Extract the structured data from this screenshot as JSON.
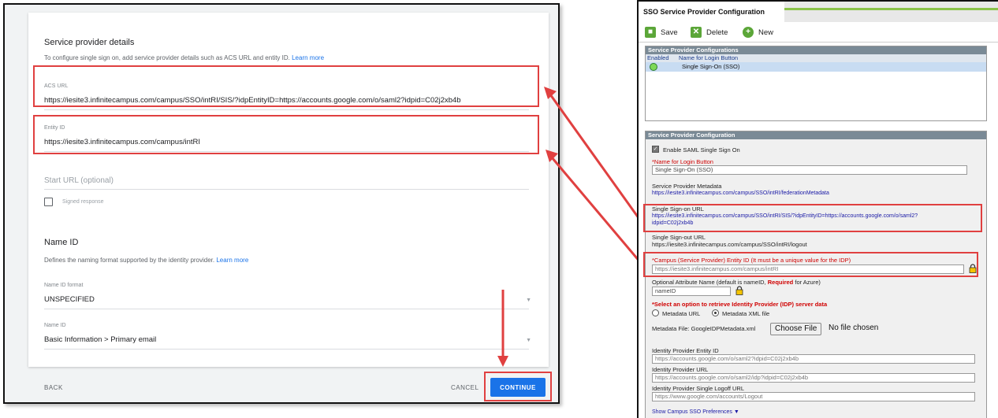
{
  "google": {
    "sp_details": {
      "title": "Service provider details",
      "desc": "To configure single sign on, add service provider details such as ACS URL and entity ID.",
      "learn_more": "Learn more"
    },
    "acs": {
      "label": "ACS URL",
      "value": "https://iesite3.infinitecampus.com/campus/SSO/intRI/SIS/?idpEntityID=https://accounts.google.com/o/saml2?idpid=C02j2xb4b"
    },
    "entity": {
      "label": "Entity ID",
      "value": "https://iesite3.infinitecampus.com/campus/intRI"
    },
    "start_url": {
      "placeholder": "Start URL (optional)"
    },
    "signed_response": {
      "label": "Signed response",
      "checked": false
    },
    "name_id": {
      "title": "Name ID",
      "desc": "Defines the naming format supported by the identity provider.",
      "learn_more": "Learn more",
      "format_label": "Name ID format",
      "format_value": "UNSPECIFIED",
      "id_label": "Name ID",
      "id_value": "Basic Information > Primary email"
    },
    "footer": {
      "back": "BACK",
      "cancel": "CANCEL",
      "continue": "CONTINUE"
    },
    "colors": {
      "primary": "#1a73e8",
      "highlight": "#e04040"
    }
  },
  "campus": {
    "tab": "SSO Service Provider Configuration",
    "toolbar": {
      "save": "Save",
      "delete": "Delete",
      "new": "New"
    },
    "list": {
      "header": "Service Provider Configurations",
      "col_enabled": "Enabled",
      "col_name": "Name for Login Button",
      "row_name": "Single Sign-On (SSO)"
    },
    "config": {
      "header": "Service Provider Configuration",
      "enable_saml": "Enable SAML Single Sign On",
      "login_button_label": "*Name for Login Button",
      "login_button_value": "Single Sign-On (SSO)",
      "sp_metadata_label": "Service Provider Metadata",
      "sp_metadata_link": "https://iesite3.infinitecampus.com/campus/SSO/intRI/federationMetadata",
      "sso_url_label": "Single Sign-on URL",
      "sso_url_line1": "https://iesite3.infinitecampus.com/campus/SSO/intRI/SIS/?idpEntityID=https://accounts.google.com/o/saml2?",
      "sso_url_line2": "idpid=C02j2xb4b",
      "slo_url_label": "Single Sign-out URL",
      "slo_url_value": "https://iesite3.infinitecampus.com/campus/SSO/intRI/logout",
      "entity_id_label": "*Campus (Service Provider) Entity ID (It must be a unique value for the IDP)",
      "entity_id_value": "https://iesite3.infinitecampus.com/campus/intRI",
      "opt_attr_label_a": "Optional Attribute Name (default is nameID,",
      "opt_attr_required": "Required",
      "opt_attr_label_b": "for Azure)",
      "opt_attr_value": "nameID",
      "idp_option_label": "*Select an option to retrieve Identity Provider (IDP) server data",
      "radio_metadata_url": "Metadata URL",
      "radio_metadata_xml": "Metadata XML file",
      "metadata_file_label": "Metadata File: GoogleIDPMetadata.xml",
      "choose_file": "Choose File",
      "no_file": "No file chosen",
      "idp_entity_label": "Identity Provider Entity ID",
      "idp_entity_value": "https://accounts.google.com/o/saml2?idpid=C02j2xb4b",
      "idp_url_label": "Identity Provider URL",
      "idp_url_value": "https://accounts.google.com/o/saml2/idp?idpid=C02j2xb4b",
      "idp_logoff_label": "Identity Provider Single Logoff URL",
      "idp_logoff_value": "https://www.google.com/accounts/Logout",
      "show_prefs": "Show Campus SSO Preferences ▼"
    }
  }
}
